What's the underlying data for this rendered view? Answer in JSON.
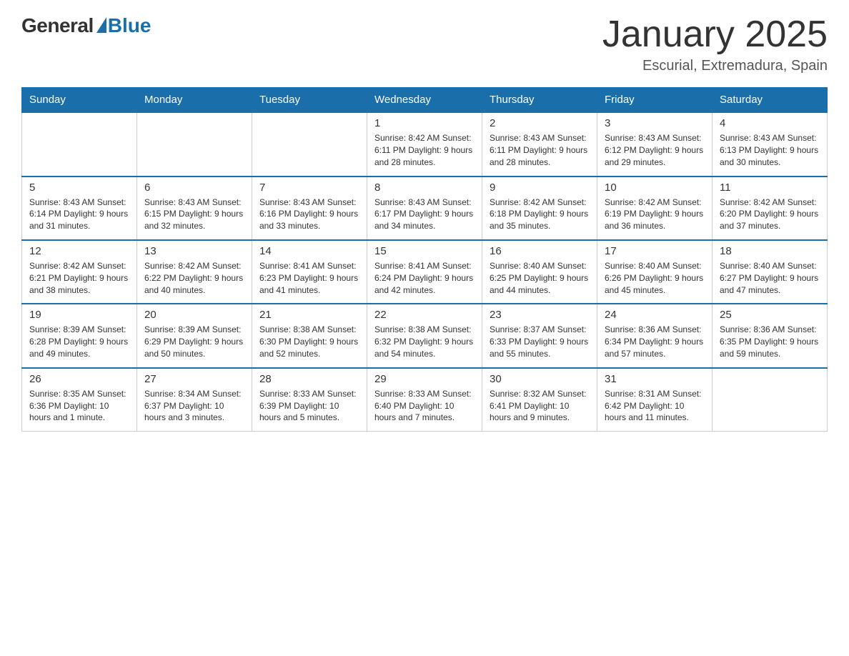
{
  "header": {
    "logo_general": "General",
    "logo_blue": "Blue",
    "calendar_title": "January 2025",
    "calendar_subtitle": "Escurial, Extremadura, Spain"
  },
  "days_of_week": [
    "Sunday",
    "Monday",
    "Tuesday",
    "Wednesday",
    "Thursday",
    "Friday",
    "Saturday"
  ],
  "weeks": [
    [
      {
        "day": "",
        "info": ""
      },
      {
        "day": "",
        "info": ""
      },
      {
        "day": "",
        "info": ""
      },
      {
        "day": "1",
        "info": "Sunrise: 8:42 AM\nSunset: 6:11 PM\nDaylight: 9 hours and 28 minutes."
      },
      {
        "day": "2",
        "info": "Sunrise: 8:43 AM\nSunset: 6:11 PM\nDaylight: 9 hours and 28 minutes."
      },
      {
        "day": "3",
        "info": "Sunrise: 8:43 AM\nSunset: 6:12 PM\nDaylight: 9 hours and 29 minutes."
      },
      {
        "day": "4",
        "info": "Sunrise: 8:43 AM\nSunset: 6:13 PM\nDaylight: 9 hours and 30 minutes."
      }
    ],
    [
      {
        "day": "5",
        "info": "Sunrise: 8:43 AM\nSunset: 6:14 PM\nDaylight: 9 hours and 31 minutes."
      },
      {
        "day": "6",
        "info": "Sunrise: 8:43 AM\nSunset: 6:15 PM\nDaylight: 9 hours and 32 minutes."
      },
      {
        "day": "7",
        "info": "Sunrise: 8:43 AM\nSunset: 6:16 PM\nDaylight: 9 hours and 33 minutes."
      },
      {
        "day": "8",
        "info": "Sunrise: 8:43 AM\nSunset: 6:17 PM\nDaylight: 9 hours and 34 minutes."
      },
      {
        "day": "9",
        "info": "Sunrise: 8:42 AM\nSunset: 6:18 PM\nDaylight: 9 hours and 35 minutes."
      },
      {
        "day": "10",
        "info": "Sunrise: 8:42 AM\nSunset: 6:19 PM\nDaylight: 9 hours and 36 minutes."
      },
      {
        "day": "11",
        "info": "Sunrise: 8:42 AM\nSunset: 6:20 PM\nDaylight: 9 hours and 37 minutes."
      }
    ],
    [
      {
        "day": "12",
        "info": "Sunrise: 8:42 AM\nSunset: 6:21 PM\nDaylight: 9 hours and 38 minutes."
      },
      {
        "day": "13",
        "info": "Sunrise: 8:42 AM\nSunset: 6:22 PM\nDaylight: 9 hours and 40 minutes."
      },
      {
        "day": "14",
        "info": "Sunrise: 8:41 AM\nSunset: 6:23 PM\nDaylight: 9 hours and 41 minutes."
      },
      {
        "day": "15",
        "info": "Sunrise: 8:41 AM\nSunset: 6:24 PM\nDaylight: 9 hours and 42 minutes."
      },
      {
        "day": "16",
        "info": "Sunrise: 8:40 AM\nSunset: 6:25 PM\nDaylight: 9 hours and 44 minutes."
      },
      {
        "day": "17",
        "info": "Sunrise: 8:40 AM\nSunset: 6:26 PM\nDaylight: 9 hours and 45 minutes."
      },
      {
        "day": "18",
        "info": "Sunrise: 8:40 AM\nSunset: 6:27 PM\nDaylight: 9 hours and 47 minutes."
      }
    ],
    [
      {
        "day": "19",
        "info": "Sunrise: 8:39 AM\nSunset: 6:28 PM\nDaylight: 9 hours and 49 minutes."
      },
      {
        "day": "20",
        "info": "Sunrise: 8:39 AM\nSunset: 6:29 PM\nDaylight: 9 hours and 50 minutes."
      },
      {
        "day": "21",
        "info": "Sunrise: 8:38 AM\nSunset: 6:30 PM\nDaylight: 9 hours and 52 minutes."
      },
      {
        "day": "22",
        "info": "Sunrise: 8:38 AM\nSunset: 6:32 PM\nDaylight: 9 hours and 54 minutes."
      },
      {
        "day": "23",
        "info": "Sunrise: 8:37 AM\nSunset: 6:33 PM\nDaylight: 9 hours and 55 minutes."
      },
      {
        "day": "24",
        "info": "Sunrise: 8:36 AM\nSunset: 6:34 PM\nDaylight: 9 hours and 57 minutes."
      },
      {
        "day": "25",
        "info": "Sunrise: 8:36 AM\nSunset: 6:35 PM\nDaylight: 9 hours and 59 minutes."
      }
    ],
    [
      {
        "day": "26",
        "info": "Sunrise: 8:35 AM\nSunset: 6:36 PM\nDaylight: 10 hours and 1 minute."
      },
      {
        "day": "27",
        "info": "Sunrise: 8:34 AM\nSunset: 6:37 PM\nDaylight: 10 hours and 3 minutes."
      },
      {
        "day": "28",
        "info": "Sunrise: 8:33 AM\nSunset: 6:39 PM\nDaylight: 10 hours and 5 minutes."
      },
      {
        "day": "29",
        "info": "Sunrise: 8:33 AM\nSunset: 6:40 PM\nDaylight: 10 hours and 7 minutes."
      },
      {
        "day": "30",
        "info": "Sunrise: 8:32 AM\nSunset: 6:41 PM\nDaylight: 10 hours and 9 minutes."
      },
      {
        "day": "31",
        "info": "Sunrise: 8:31 AM\nSunset: 6:42 PM\nDaylight: 10 hours and 11 minutes."
      },
      {
        "day": "",
        "info": ""
      }
    ]
  ]
}
